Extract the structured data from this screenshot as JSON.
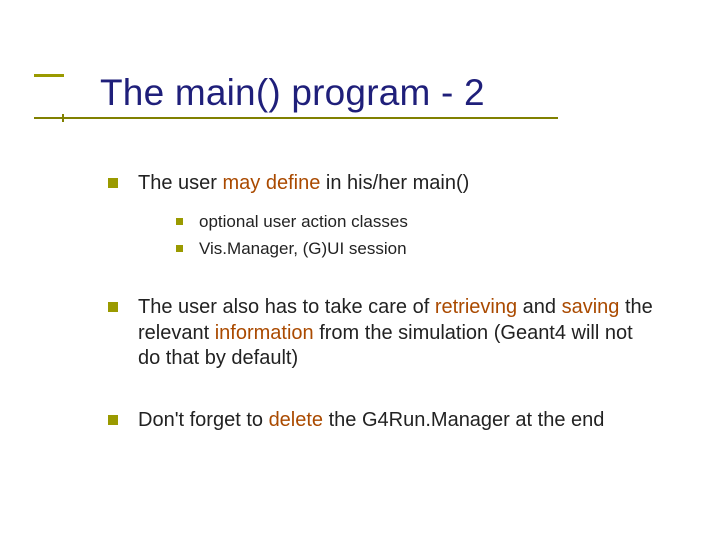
{
  "title": "The main() program - 2",
  "b1": {
    "pre": "The user ",
    "k": "may define",
    "post": " in his/her main()"
  },
  "sub1": "optional user action classes",
  "sub2": "Vis.Manager, (G)UI session",
  "b2": {
    "pre": "The user also has to take care of ",
    "k1": "retrieving",
    "mid1": " and ",
    "k2": "saving",
    "mid2": " the relevant ",
    "k3": "information",
    "post": " from the simulation (Geant4 will not do that by default)"
  },
  "b3": {
    "pre": "Don't forget to ",
    "k": "delete",
    "post": " the G4Run.Manager at the end"
  }
}
